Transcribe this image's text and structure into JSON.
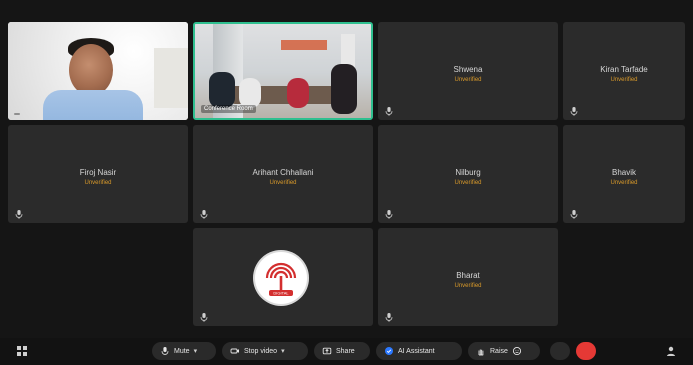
{
  "participants": [
    {
      "caption": ""
    },
    {
      "caption": "Conference Room"
    },
    {
      "name": "Shwena",
      "status": "Unverified"
    },
    {
      "name": "Kiran Tarfade",
      "status": "Unverified"
    },
    {
      "name": "Firoj Nasir",
      "status": "Unverified"
    },
    {
      "name": "Arihant Chhallani",
      "status": "Unverified"
    },
    {
      "name": "Nilburg",
      "status": "Unverified"
    },
    {
      "name": "Bhavik",
      "status": "Unverified"
    },
    {
      "logo_text": "DIGITAL"
    },
    {
      "name": "Bharat",
      "status": "Unverified"
    }
  ],
  "toolbar": {
    "mute": "Mute",
    "stop_video": "Stop video",
    "share": "Share",
    "ai_assistant": "AI Assistant",
    "raise": "Raise"
  },
  "colors": {
    "accent_active": "#2fbf8f",
    "status_text": "#d99a2b",
    "leave_button": "#e53935"
  },
  "icons": {
    "mic": "mic-icon",
    "video": "video-icon",
    "share": "share-icon",
    "ai": "ai-assistant-icon",
    "raise": "raise-hand-icon",
    "emoji": "emoji-icon",
    "grid": "grid-icon",
    "people": "participants-icon"
  }
}
